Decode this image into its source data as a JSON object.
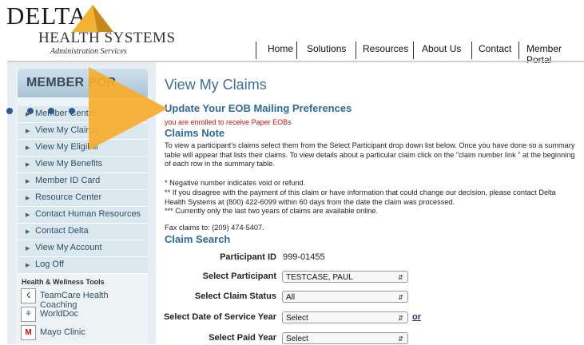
{
  "logo": {
    "word": "DELTA",
    "sub": "HEALTH SYSTEMS",
    "tag": "Administration Services"
  },
  "nav": [
    "Home",
    "Solutions",
    "Resources",
    "About Us",
    "Contact",
    "Member Portal"
  ],
  "sidebar": {
    "title": "MEMBER POR",
    "items": [
      "Member Center",
      "View My Claims",
      "View My Eligibili",
      "View My Benefits",
      "Member ID Card",
      "Resource Center",
      "Contact Human Resources",
      "Contact Delta",
      "View My Account",
      "Log Off"
    ],
    "hw_title": "Health & Wellness Tools",
    "hw_items": [
      "TeamCare Health Coaching",
      "WorldDoc",
      "Mayo Clinic"
    ]
  },
  "main": {
    "title": "View My Claims",
    "update_link": "Update Your EOB Mailing Preferences",
    "enrolled": "you are enrolled to receive Paper EOBs",
    "claims_note": "Claims Note",
    "para1": "To view a participant's claims select them from the Select Participant drop down list below. Once you have done so a summary table will appear that lists their claims. To view details about a particular claim click on the \"claim number link \" at the beginning of each row in the summary table.",
    "notes": [
      "* Negative number indicates void or refund.",
      "** If you disagree with the payment of this claim or have information that could change our decision, please contact Delta Health Systems at (800) 422-6099 within 60 days from the date the claim was processed.",
      "*** Currently only the last two years of claims are available online."
    ],
    "fax": "Fax claims to: (209) 474-5407.",
    "claim_search": "Claim Search",
    "participant_id_label": "Participant ID",
    "participant_id": "999-01455",
    "select_participant_label": "Select Participant",
    "select_participant": "TESTCASE, PAUL",
    "claim_status_label": "Select Claim Status",
    "claim_status": "All",
    "dos_year_label": "Select Date of Service Year",
    "dos_year": "Select",
    "or": "or",
    "paid_year_label": "Select Paid Year",
    "paid_year": "Select"
  },
  "colors": {
    "accent": "#2d6a97",
    "arrow": "#f5a623",
    "alert": "#d01010"
  }
}
